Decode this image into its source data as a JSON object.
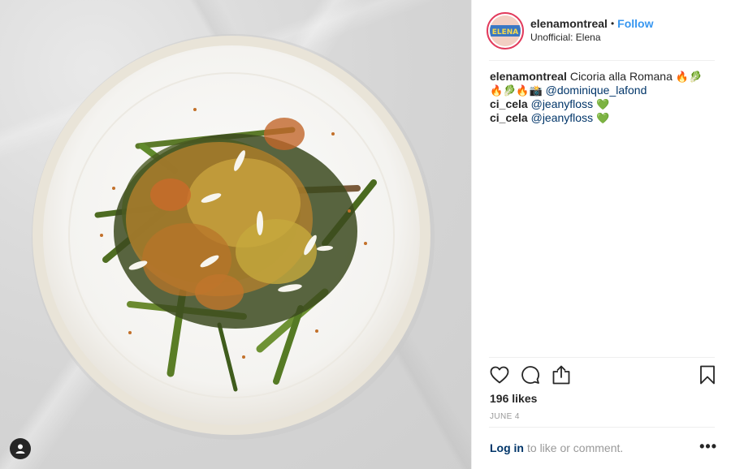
{
  "post": {
    "username": "elenamontreal",
    "follow_label": "Follow",
    "separator": "•",
    "location": "Unofficial: Elena",
    "avatar_text": "ELENA"
  },
  "caption": {
    "line1_user": "elenamontreal",
    "line1_text": "Cicoria alla Romana",
    "line1_emojis": "🔥🥬",
    "line2_emojis": "🔥🥬🔥📸",
    "line2_mention": "@dominique_lafond",
    "credits": [
      {
        "user": "ci_cela",
        "mention": "@jeanyfloss",
        "emoji": "💚"
      },
      {
        "user": "ci_cela",
        "mention": "@jeanyfloss",
        "emoji": "💚"
      }
    ]
  },
  "actions": {
    "like_icon": "heart-icon",
    "comment_icon": "comment-icon",
    "share_icon": "share-icon",
    "save_icon": "bookmark-icon"
  },
  "stats": {
    "likes": "196 likes",
    "date": "JUNE 4"
  },
  "footer": {
    "login_label": "Log in",
    "login_suffix": "to like or comment.",
    "more_label": "•••"
  },
  "colors": {
    "follow": "#3897f0",
    "mention": "#003569",
    "avatar_ring": "#e23b5c",
    "muted": "#999999"
  }
}
